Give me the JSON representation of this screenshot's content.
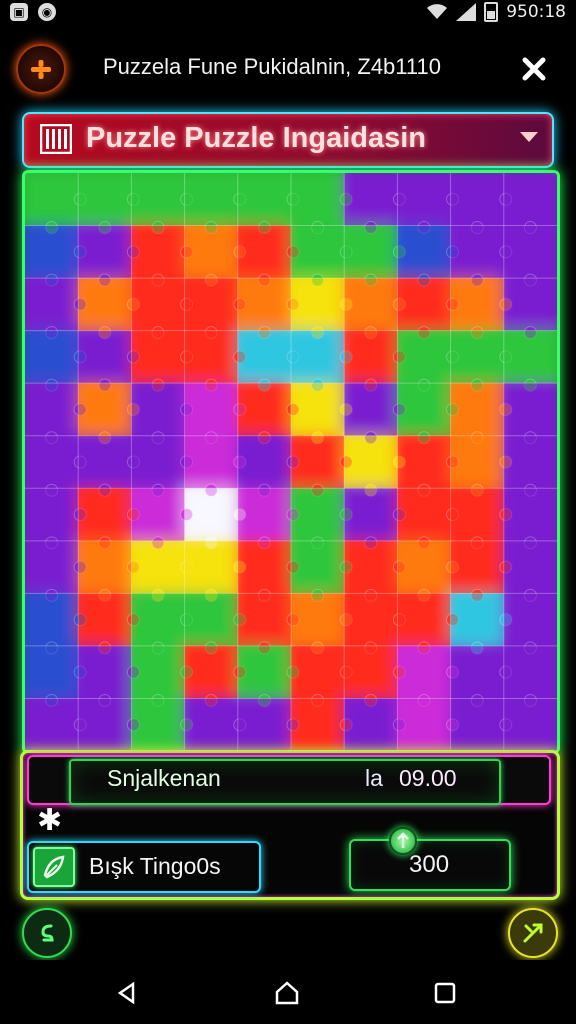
{
  "status_bar": {
    "time": "950:18",
    "left_icons": [
      "lock-icon",
      "globe-icon"
    ],
    "right_icons": [
      "wifi-icon",
      "signal-icon",
      "battery-icon"
    ]
  },
  "header": {
    "title": "Puzzela Fune Pukidalnin, Z4b1110",
    "menu_icon": "plus-icon",
    "close_icon": "close-icon"
  },
  "puzzle_select": {
    "selected": "Puzzle Puzzle Ingaidasin",
    "icon": "barcode-icon"
  },
  "board": {
    "columns": 10,
    "rows": 11,
    "colors": {
      "green": "#2dc63c",
      "red": "#ff2b1f",
      "orange": "#ff7a10",
      "yellow": "#f6e20c",
      "purple": "#7a1fd0",
      "magenta": "#cc2bd9",
      "blue": "#2a4fd0",
      "cyan": "#2fc6e0",
      "white": "#f8f8ff"
    },
    "grid": [
      [
        "green",
        "green",
        "green",
        "green",
        "green",
        "green",
        "purple",
        "purple",
        "purple",
        "purple"
      ],
      [
        "blue",
        "purple",
        "red",
        "orange",
        "red",
        "green",
        "green",
        "blue",
        "purple",
        "purple"
      ],
      [
        "purple",
        "orange",
        "red",
        "red",
        "orange",
        "yellow",
        "orange",
        "red",
        "orange",
        "purple"
      ],
      [
        "blue",
        "purple",
        "red",
        "red",
        "cyan",
        "cyan",
        "red",
        "green",
        "green",
        "green"
      ],
      [
        "purple",
        "orange",
        "purple",
        "magenta",
        "red",
        "yellow",
        "purple",
        "green",
        "orange",
        "purple"
      ],
      [
        "purple",
        "purple",
        "purple",
        "magenta",
        "purple",
        "red",
        "yellow",
        "red",
        "orange",
        "purple"
      ],
      [
        "purple",
        "red",
        "magenta",
        "white",
        "magenta",
        "green",
        "purple",
        "red",
        "red",
        "purple"
      ],
      [
        "purple",
        "orange",
        "yellow",
        "yellow",
        "red",
        "green",
        "red",
        "orange",
        "red",
        "purple"
      ],
      [
        "blue",
        "red",
        "green",
        "green",
        "red",
        "orange",
        "red",
        "red",
        "cyan",
        "purple"
      ],
      [
        "blue",
        "purple",
        "green",
        "red",
        "green",
        "red",
        "red",
        "magenta",
        "purple",
        "purple"
      ],
      [
        "purple",
        "purple",
        "green",
        "purple",
        "purple",
        "red",
        "purple",
        "magenta",
        "purple",
        "purple"
      ]
    ]
  },
  "score": {
    "label": "Snjalkenan",
    "prefix": "la",
    "value": "09.00"
  },
  "star_icon": "asterisk-icon",
  "bonus": {
    "label": "Bışk Tingo0s",
    "icon": "leaf-icon"
  },
  "counter": {
    "value": "300",
    "knob_icon": "up-arrow-icon"
  },
  "fabs": {
    "left_icon": "swap-icon",
    "right_icon": "shuffle-icon"
  },
  "nav": {
    "items": [
      "back-icon",
      "home-icon",
      "recents-icon"
    ]
  }
}
